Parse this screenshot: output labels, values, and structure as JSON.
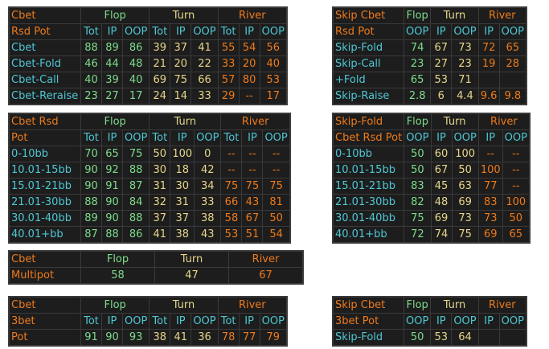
{
  "tables": [
    {
      "title": "Cbet",
      "subtitle": "Rsd Pot",
      "groups": [
        "Flop",
        "Turn",
        "River"
      ],
      "cols": [
        "Tot",
        "IP",
        "OOP",
        "Tot",
        "IP",
        "OOP",
        "Tot",
        "IP",
        "OOP"
      ],
      "rows": [
        {
          "label": "Cbet",
          "vals": [
            "88",
            "89",
            "86",
            "39",
            "37",
            "41",
            "55",
            "54",
            "56"
          ]
        },
        {
          "label": "Cbet-Fold",
          "vals": [
            "46",
            "44",
            "48",
            "21",
            "20",
            "22",
            "33",
            "20",
            "40"
          ]
        },
        {
          "label": "Cbet-Call",
          "vals": [
            "40",
            "39",
            "40",
            "69",
            "75",
            "66",
            "57",
            "80",
            "53"
          ]
        },
        {
          "label": "Cbet-Reraise",
          "vals": [
            "23",
            "27",
            "17",
            "24",
            "14",
            "33",
            "29",
            "--",
            "17"
          ]
        }
      ]
    },
    {
      "title": "Skip Cbet",
      "subtitle": "Rsd Pot",
      "groups": [
        "Flop",
        "Turn",
        "River"
      ],
      "cols": [
        "OOP",
        "IP",
        "OOP",
        "IP",
        "OOP"
      ],
      "rows": [
        {
          "label": "Skip-Fold",
          "vals": [
            "74",
            "67",
            "73",
            "72",
            "65"
          ]
        },
        {
          "label": "Skip-Call",
          "vals": [
            "23",
            "27",
            "23",
            "19",
            "28"
          ]
        },
        {
          "label": "+Fold",
          "vals": [
            "65",
            "53",
            "71",
            "",
            ""
          ]
        },
        {
          "label": "Skip-Raise",
          "vals": [
            "2.8",
            "6",
            "4.4",
            "9.6",
            "9.8"
          ]
        }
      ]
    },
    {
      "title": "Cbet Rsd",
      "subtitle": "Pot",
      "groups": [
        "Flop",
        "Turn",
        "River"
      ],
      "cols": [
        "Tot",
        "IP",
        "OOP",
        "Tot",
        "IP",
        "OOP",
        "Tot",
        "IP",
        "OOP"
      ],
      "rows": [
        {
          "label": "0-10bb",
          "vals": [
            "70",
            "65",
            "75",
            "50",
            "100",
            "0",
            "--",
            "--",
            "--"
          ]
        },
        {
          "label": "10.01-15bb",
          "vals": [
            "90",
            "92",
            "88",
            "30",
            "18",
            "42",
            "--",
            "--",
            "--"
          ]
        },
        {
          "label": "15.01-21bb",
          "vals": [
            "90",
            "91",
            "87",
            "31",
            "30",
            "34",
            "75",
            "75",
            "75"
          ]
        },
        {
          "label": "21.01-30bb",
          "vals": [
            "88",
            "90",
            "84",
            "32",
            "31",
            "33",
            "66",
            "43",
            "81"
          ]
        },
        {
          "label": "30.01-40bb",
          "vals": [
            "89",
            "90",
            "88",
            "37",
            "37",
            "38",
            "58",
            "67",
            "50"
          ]
        },
        {
          "label": "40.01+bb",
          "vals": [
            "87",
            "88",
            "86",
            "41",
            "38",
            "43",
            "53",
            "51",
            "54"
          ]
        }
      ]
    },
    {
      "title": "Skip-Fold",
      "subtitle": "Cbet Rsd Pot",
      "groups": [
        "Flop",
        "Turn",
        "River"
      ],
      "cols": [
        "OOP",
        "IP",
        "OOP",
        "IP",
        "OOP"
      ],
      "rows": [
        {
          "label": "0-10bb",
          "vals": [
            "50",
            "60",
            "100",
            "--",
            "--"
          ]
        },
        {
          "label": "10.01-15bb",
          "vals": [
            "50",
            "67",
            "50",
            "100",
            "--"
          ]
        },
        {
          "label": "15.01-21bb",
          "vals": [
            "83",
            "45",
            "63",
            "77",
            "--"
          ]
        },
        {
          "label": "21.01-30bb",
          "vals": [
            "82",
            "48",
            "69",
            "83",
            "100"
          ]
        },
        {
          "label": "30.01-40bb",
          "vals": [
            "75",
            "69",
            "73",
            "73",
            "50"
          ]
        },
        {
          "label": "40.01+bb",
          "vals": [
            "72",
            "74",
            "75",
            "69",
            "65"
          ]
        }
      ]
    },
    {
      "title": "Cbet",
      "subtitle": "Multipot",
      "groups": [
        "Flop",
        "Turn",
        "River"
      ],
      "vals": [
        "58",
        "47",
        "67"
      ]
    },
    {
      "title": "Cbet",
      "subtitle": "3bet",
      "groups": [
        "Flop",
        "Turn",
        "River"
      ],
      "cols": [
        "Tot",
        "IP",
        "OOP",
        "Tot",
        "IP",
        "OOP",
        "Tot",
        "IP",
        "OOP"
      ],
      "rows": [
        {
          "label": "Pot",
          "vals": [
            "91",
            "90",
            "93",
            "38",
            "41",
            "36",
            "78",
            "77",
            "79"
          ]
        }
      ]
    },
    {
      "title": "Skip Cbet",
      "subtitle": "3bet Pot",
      "groups": [
        "Flop",
        "Turn",
        "River"
      ],
      "cols": [
        "OOP",
        "IP",
        "OOP",
        "IP",
        "OOP"
      ],
      "rows": [
        {
          "label": "Skip-Fold",
          "vals": [
            "50",
            "53",
            "64",
            "",
            ""
          ]
        }
      ]
    }
  ],
  "colors": {
    "orange": "#ef7a1a",
    "green": "#7ddc8c",
    "teal": "#4ec7d4",
    "yellow": "#e6d68a",
    "bg": "#1d1d1d",
    "border": "#3a3a3a"
  }
}
